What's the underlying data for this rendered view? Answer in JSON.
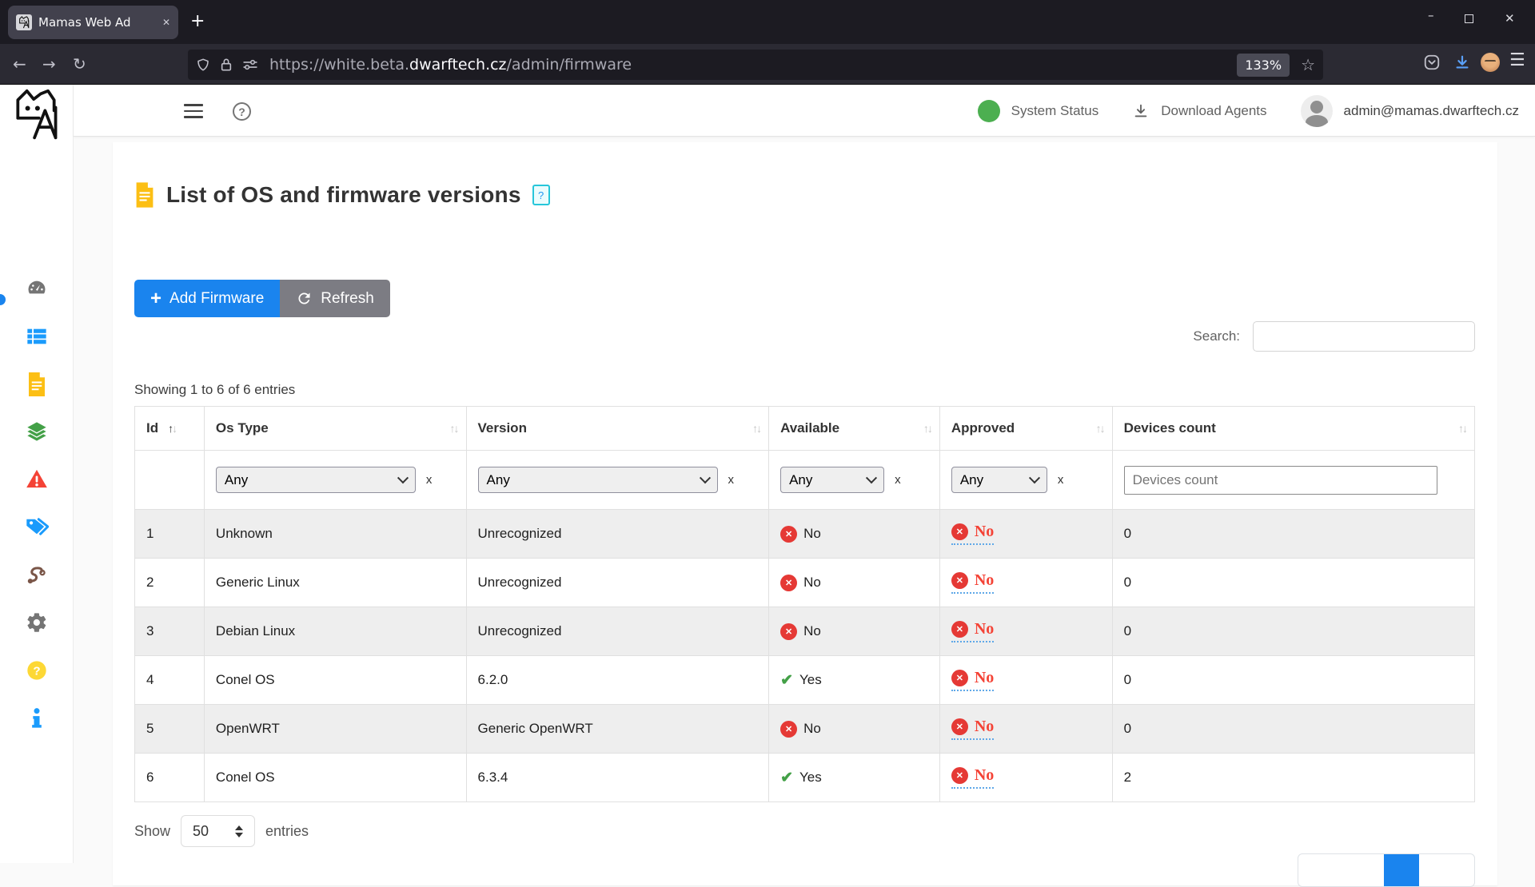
{
  "browser": {
    "tab_title": "Mamas Web Ad",
    "url": {
      "prefix": "https://white.beta.",
      "domain": "dwarftech.cz",
      "path": "/admin/firmware"
    },
    "zoom_level": "133%"
  },
  "icons": {
    "new_tab": "+",
    "tab_close": "✕",
    "window_minimize": "–",
    "window_close": "✕",
    "back": "←",
    "forward": "→",
    "reload": "↻",
    "star": "☆",
    "menu": "☰",
    "help_mark": "?",
    "plus": "+",
    "sort_up": "↑",
    "sort_down": "↓",
    "cross": "✕",
    "check": "✔"
  },
  "header": {
    "system_status_label": "System Status",
    "download_agents_label": "Download Agents",
    "user_email": "admin@mamas.dwarftech.cz"
  },
  "sidebar": {
    "items": [
      "dashboard",
      "device-table",
      "firmware",
      "groups",
      "alerts",
      "tags",
      "routes",
      "settings",
      "help",
      "info"
    ],
    "active_item": "firmware"
  },
  "page": {
    "title": "List of OS and firmware versions",
    "buttons": {
      "add": "Add Firmware",
      "refresh": "Refresh"
    },
    "search_label": "Search:",
    "search_value": "",
    "showing_text": "Showing 1 to 6 of 6 entries",
    "show_label": "Show",
    "entries_label": "entries",
    "page_size": "50"
  },
  "filters": {
    "any_label": "Any",
    "clear_label": "x",
    "devices_count_placeholder": "Devices count"
  },
  "table": {
    "columns": [
      "Id",
      "Os Type",
      "Version",
      "Available",
      "Approved",
      "Devices count"
    ],
    "sorted_column": "Id",
    "sort_direction": "asc",
    "rows": [
      {
        "id": "1",
        "os_type": "Unknown",
        "version": "Unrecognized",
        "available": "No",
        "approved": "No",
        "devices_count": "0"
      },
      {
        "id": "2",
        "os_type": "Generic Linux",
        "version": "Unrecognized",
        "available": "No",
        "approved": "No",
        "devices_count": "0"
      },
      {
        "id": "3",
        "os_type": "Debian Linux",
        "version": "Unrecognized",
        "available": "No",
        "approved": "No",
        "devices_count": "0"
      },
      {
        "id": "4",
        "os_type": "Conel OS",
        "version": "6.2.0",
        "available": "Yes",
        "approved": "No",
        "devices_count": "0"
      },
      {
        "id": "5",
        "os_type": "OpenWRT",
        "version": "Generic OpenWRT",
        "available": "No",
        "approved": "No",
        "devices_count": "0"
      },
      {
        "id": "6",
        "os_type": "Conel OS",
        "version": "6.3.4",
        "available": "Yes",
        "approved": "No",
        "devices_count": "2"
      }
    ]
  },
  "colors": {
    "accent_blue": "#1a84ee",
    "success_green": "#4caf50",
    "danger_red": "#e53935",
    "approved_no_red": "#f44336",
    "dotted_underline_blue": "#5fa8e8",
    "file_icon_amber": "#fcbf14"
  }
}
